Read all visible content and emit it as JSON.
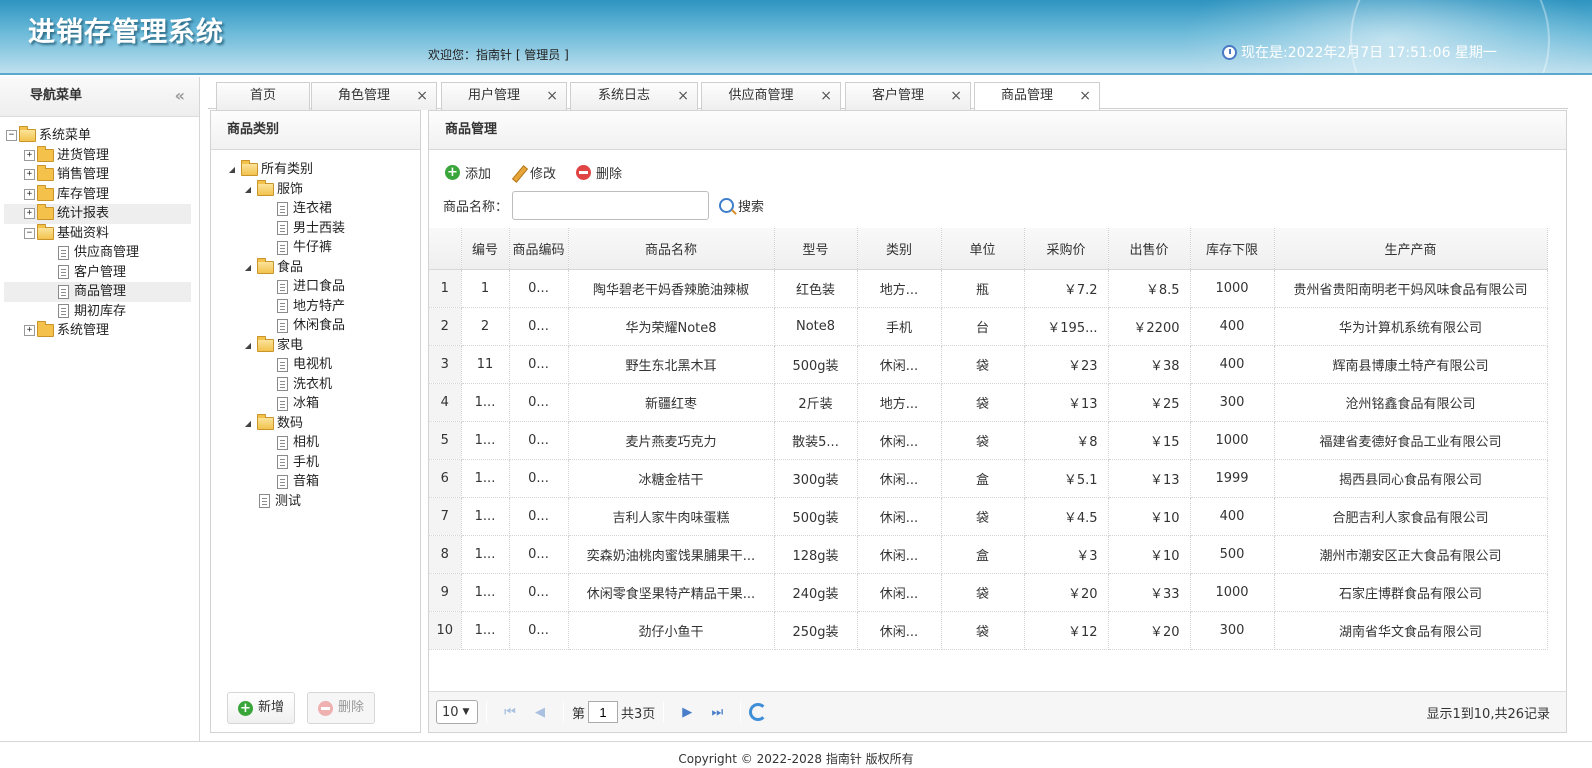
{
  "header": {
    "app_title": "进销存管理系统",
    "welcome": "欢迎您：指南针 [ 管理员 ]",
    "clock": "现在是:2022年2月7日 17:51:06 星期一"
  },
  "nav": {
    "title": "导航菜单",
    "collapse": "«",
    "root": "系统菜单",
    "items": [
      "进货管理",
      "销售管理",
      "库存管理",
      "统计报表",
      "基础资料"
    ],
    "basic_children": [
      "供应商管理",
      "客户管理",
      "商品管理",
      "期初库存"
    ],
    "system": "系统管理"
  },
  "tabs": [
    {
      "label": "首页"
    },
    {
      "label": "角色管理",
      "close": "×"
    },
    {
      "label": "用户管理",
      "close": "×"
    },
    {
      "label": "系统日志",
      "close": "×"
    },
    {
      "label": "供应商管理",
      "close": "×"
    },
    {
      "label": "客户管理",
      "close": "×"
    },
    {
      "label": "商品管理",
      "close": "×"
    }
  ],
  "category_panel": {
    "title": "商品类别",
    "root": "所有类别",
    "groups": [
      {
        "name": "服饰",
        "children": [
          "连衣裙",
          "男士西装",
          "牛仔裤"
        ]
      },
      {
        "name": "食品",
        "children": [
          "进口食品",
          "地方特产",
          "休闲食品"
        ]
      },
      {
        "name": "家电",
        "children": [
          "电视机",
          "洗衣机",
          "冰箱"
        ]
      },
      {
        "name": "数码",
        "children": [
          "相机",
          "手机",
          "音箱"
        ]
      }
    ],
    "extra": "测试",
    "add_label": "新增",
    "delete_label": "删除"
  },
  "goods_panel": {
    "title": "商品管理",
    "toolbar": {
      "add": "添加",
      "edit": "修改",
      "delete": "删除"
    },
    "search_label": "商品名称：",
    "search_value": "",
    "search_button": "搜索",
    "columns": [
      "",
      "编号",
      "商品编码",
      "商品名称",
      "型号",
      "类别",
      "单位",
      "采购价",
      "出售价",
      "库存下限",
      "生产产商"
    ],
    "rows": [
      [
        "1",
        "1",
        "0...",
        "陶华碧老干妈香辣脆油辣椒",
        "红色装",
        "地方...",
        "瓶",
        "￥7.2",
        "￥8.5",
        "1000",
        "贵州省贵阳南明老干妈风味食品有限公司"
      ],
      [
        "2",
        "2",
        "0...",
        "华为荣耀Note8",
        "Note8",
        "手机",
        "台",
        "￥195...",
        "￥2200",
        "400",
        "华为计算机系统有限公司"
      ],
      [
        "3",
        "11",
        "0...",
        "野生东北黑木耳",
        "500g装",
        "休闲...",
        "袋",
        "￥23",
        "￥38",
        "400",
        "辉南县博康土特产有限公司"
      ],
      [
        "4",
        "1...",
        "0...",
        "新疆红枣",
        "2斤装",
        "地方...",
        "袋",
        "￥13",
        "￥25",
        "300",
        "沧州铭鑫食品有限公司"
      ],
      [
        "5",
        "1...",
        "0...",
        "麦片燕麦巧克力",
        "散装5...",
        "休闲...",
        "袋",
        "￥8",
        "￥15",
        "1000",
        "福建省麦德好食品工业有限公司"
      ],
      [
        "6",
        "1...",
        "0...",
        "冰糖金桔干",
        "300g装",
        "休闲...",
        "盒",
        "￥5.1",
        "￥13",
        "1999",
        "揭西县同心食品有限公司"
      ],
      [
        "7",
        "1...",
        "0...",
        "吉利人家牛肉味蛋糕",
        "500g装",
        "休闲...",
        "袋",
        "￥4.5",
        "￥10",
        "400",
        "合肥吉利人家食品有限公司"
      ],
      [
        "8",
        "1...",
        "0...",
        "奕森奶油桃肉蜜饯果脯果干...",
        "128g装",
        "休闲...",
        "盒",
        "￥3",
        "￥10",
        "500",
        "潮州市潮安区正大食品有限公司"
      ],
      [
        "9",
        "1...",
        "0...",
        "休闲零食坚果特产精品干果...",
        "240g装",
        "休闲...",
        "袋",
        "￥20",
        "￥33",
        "1000",
        "石家庄博群食品有限公司"
      ],
      [
        "10",
        "1...",
        "0...",
        "劲仔小鱼干",
        "250g装",
        "休闲...",
        "袋",
        "￥12",
        "￥20",
        "300",
        "湖南省华文食品有限公司"
      ]
    ],
    "pager": {
      "page_size": "10",
      "page_prefix": "第",
      "page_num": "1",
      "page_suffix": "共3页",
      "info": "显示1到10,共26记录"
    }
  },
  "footer": "Copyright © 2022-2028 指南针 版权所有"
}
